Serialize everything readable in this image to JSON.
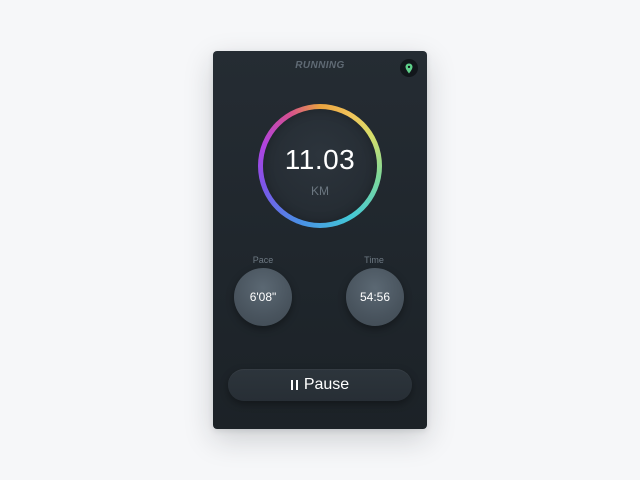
{
  "app": {
    "title": "RUNNING"
  },
  "header": {
    "location_icon": "map-pin-icon",
    "location_icon_color": "#5fd08a"
  },
  "distance": {
    "value": "11.03",
    "unit": "KM"
  },
  "stats": {
    "pace": {
      "label": "Pace",
      "value": "6'08\""
    },
    "time": {
      "label": "Time",
      "value": "54:56"
    }
  },
  "controls": {
    "pause_icon": "pause-icon",
    "pause_label": "Pause"
  },
  "colors": {
    "background": "#f6f7f9",
    "card": "#232a31",
    "ring_gradient": [
      "#e9a23f",
      "#f3c45a",
      "#7fd99a",
      "#43c8d8",
      "#4a8fe6",
      "#7b56e8",
      "#b143e0",
      "#d5508f"
    ],
    "text_primary": "#ffffff",
    "text_muted": "#6b7680"
  }
}
